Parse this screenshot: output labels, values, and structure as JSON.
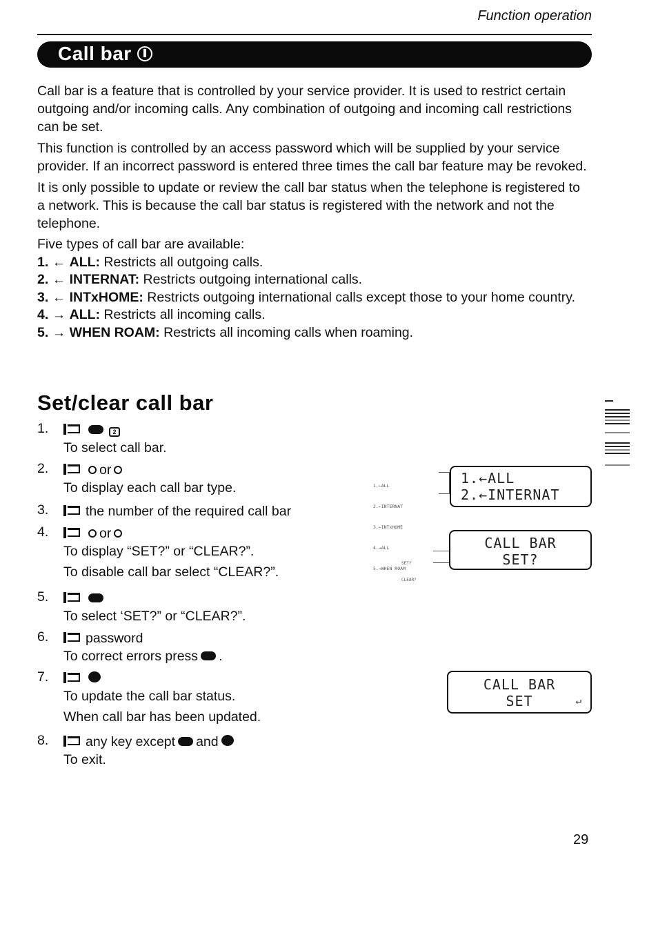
{
  "header": {
    "section_label": "Function operation"
  },
  "title": {
    "text": "Call bar",
    "icon": "menu-key-icon"
  },
  "intro": {
    "paragraphs": [
      "Call bar is a feature that is controlled by your service provider. It is used to restrict certain outgoing and/or incoming calls. Any combination of outgoing and incoming call restrictions can be set.",
      "This function is controlled by an access password which will be supplied by your service provider. If an incorrect password is entered three times the call bar feature may be revoked.",
      "It is only possible to update or review the call bar status when the telephone is registered to a network. This is because the call bar status is registered with the network and not the telephone."
    ],
    "types_heading": "Five types of call bar are available:",
    "types": [
      {
        "num": "1.",
        "arrow": "←",
        "key": "ALL:",
        "desc": " Restricts all outgoing calls."
      },
      {
        "num": "2.",
        "arrow": "←",
        "key": "INTERNAT:",
        "desc": " Restricts outgoing international calls."
      },
      {
        "num": "3.",
        "arrow": "←",
        "key": "INTxHOME:",
        "desc": " Restricts outgoing international calls except those to your home country."
      },
      {
        "num": "4.",
        "arrow": "→",
        "key": "ALL:",
        "desc": " Restricts all incoming calls."
      },
      {
        "num": "5.",
        "arrow": "→",
        "key": "WHEN ROAM:",
        "desc": " Restricts all incoming calls when roaming."
      }
    ]
  },
  "procedure": {
    "heading": "Set/clear call bar",
    "steps": [
      {
        "num": "1.",
        "action": "",
        "action_icons": [
          "menu-key-icon",
          "key-2-icon"
        ],
        "notes": [
          "To select call bar."
        ]
      },
      {
        "num": "2.",
        "action_prefix": "",
        "or_label": "or",
        "action_icons": [
          "scroll-up-key-icon",
          "scroll-down-key-icon"
        ],
        "notes": [
          "To display each call bar type."
        ]
      },
      {
        "num": "3.",
        "action": "the number of the required call bar",
        "notes": []
      },
      {
        "num": "4.",
        "or_label": "or",
        "action_icons": [
          "scroll-up-key-icon",
          "scroll-down-key-icon"
        ],
        "notes": [
          "To display “SET?” or “CLEAR?”.",
          "To disable call bar select “CLEAR?”."
        ]
      },
      {
        "num": "5.",
        "action_icons": [
          "memory-key-icon"
        ],
        "notes": [
          "To select ‘SET?” or “CLEAR?”."
        ]
      },
      {
        "num": "6.",
        "action": "password",
        "notes": [
          "To correct errors press"
        ]
      },
      {
        "num": "7.",
        "action_icons": [
          "send-key-icon"
        ],
        "notes": [
          "To update the call bar status.",
          "When call bar has been updated."
        ]
      },
      {
        "num": "8.",
        "action": "any key except",
        "and_label": "and",
        "notes": [
          "To exit."
        ]
      }
    ]
  },
  "displays": {
    "lcd1": {
      "lines": [
        "1.←ALL",
        "2.←INTERNAT"
      ],
      "mini_list": [
        "1.←ALL",
        "2.←INTERNAT",
        "3.←INTxHOME",
        "4.→ALL",
        "5.→WHEN ROAM"
      ]
    },
    "lcd2": {
      "lines": [
        "CALL BAR",
        "SET?"
      ],
      "mini_list": [
        "SET?",
        "CLEAR?"
      ]
    },
    "lcd3": {
      "lines": [
        "CALL BAR",
        "SET"
      ],
      "indicator": "↵"
    }
  },
  "footer": {
    "page_number": "29"
  }
}
